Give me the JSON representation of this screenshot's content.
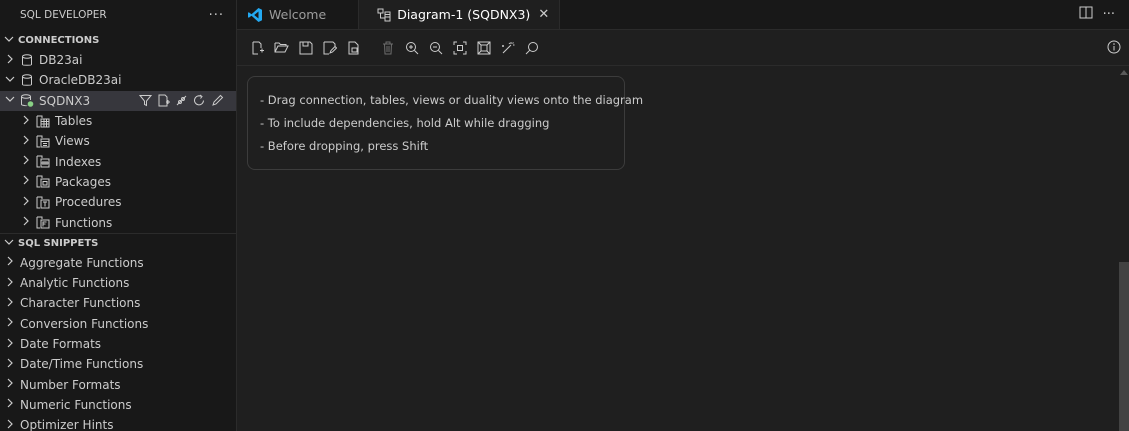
{
  "sidebar": {
    "title": "SQL DEVELOPER",
    "more": "···",
    "connections_header": "CONNECTIONS",
    "connections": [
      {
        "label": "DB23ai"
      },
      {
        "label": "OracleDB23ai"
      },
      {
        "label": "SQDNX3"
      }
    ],
    "objects": [
      {
        "label": "Tables"
      },
      {
        "label": "Views"
      },
      {
        "label": "Indexes"
      },
      {
        "label": "Packages"
      },
      {
        "label": "Procedures"
      },
      {
        "label": "Functions"
      }
    ],
    "snippets_header": "SQL SNIPPETS",
    "snippets": [
      {
        "label": "Aggregate Functions"
      },
      {
        "label": "Analytic Functions"
      },
      {
        "label": "Character Functions"
      },
      {
        "label": "Conversion Functions"
      },
      {
        "label": "Date Formats"
      },
      {
        "label": "Date/Time Functions"
      },
      {
        "label": "Number Formats"
      },
      {
        "label": "Numeric Functions"
      },
      {
        "label": "Optimizer Hints"
      }
    ]
  },
  "tabs": [
    {
      "label": "Welcome",
      "active": false
    },
    {
      "label": "Diagram-1 (SQDNX3)",
      "active": true
    }
  ],
  "tab_close": "✕",
  "tabbar_more": "···",
  "hint": {
    "lines": [
      "- Drag connection, tables, views or duality views onto the diagram",
      "- To include dependencies, hold Alt while dragging",
      "- Before dropping, press Shift"
    ]
  },
  "colors": {
    "accent_blue": "#23a9f2",
    "background": "#1f1f1f",
    "sidebar_bg": "#181818",
    "selected_row": "#37373d",
    "connected_green": "#89d185"
  }
}
